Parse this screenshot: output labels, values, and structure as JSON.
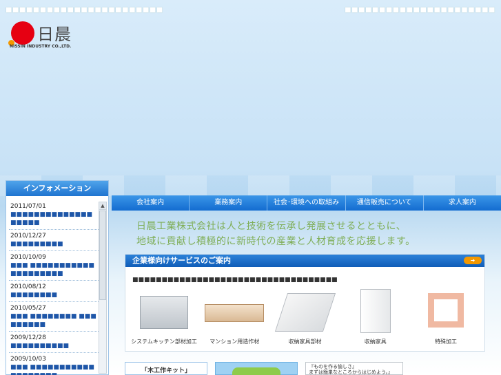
{
  "top": {
    "left_text": "■■■■■■■■■■■■■■■■■■■■■■■",
    "right_text": "■■■■■■■■■■■■■■■■■■■■■■"
  },
  "logo": {
    "mark": "日晨",
    "sub": "NISSIN INDUSTRY CO.,LTD."
  },
  "info": {
    "header": "インフォメーション",
    "items": [
      {
        "date": "2011/07/01",
        "title": "■■■■■■■■■■■■■■■■■■■"
      },
      {
        "date": "2010/12/27",
        "title": "■■■■■■■■■"
      },
      {
        "date": "2010/10/09",
        "title": "■■■ ■■■■■■■■■■■■■■■■■■■■"
      },
      {
        "date": "2010/08/12",
        "title": "■■■■■■■■"
      },
      {
        "date": "2010/05/27",
        "title": "■■■ ■■■■■■■■ ■■■■■■■■■"
      },
      {
        "date": "2009/12/28",
        "title": "■■■■■■■■■■"
      },
      {
        "date": "2009/10/03",
        "title": "■■■ ■■■■■■■■■■■■■■■■■■■"
      }
    ]
  },
  "nav": {
    "items": [
      "会社案内",
      "業務案内",
      "社会･環境への取組み",
      "通信販売について",
      "求人案内"
    ]
  },
  "catch": {
    "line1": "日晨工業株式会社は人と技術を伝承し発展させるとともに、",
    "line2": "地域に貢献し積極的に新時代の産業と人材育成を応援します。"
  },
  "service": {
    "title": "企業様向けサービスのご案内",
    "arrow": "➜",
    "desc": "■■■■■■■■■■■■■■■■■■■■■■■■■■■■■■■■■■■",
    "products": [
      {
        "label": "システムキッチン部材加工"
      },
      {
        "label": "マンション用造作材"
      },
      {
        "label": "収納家具部材"
      },
      {
        "label": "収納家具"
      },
      {
        "label": "特殊加工"
      }
    ]
  },
  "bottom": {
    "box1": "「木工作キット」",
    "box3_line1": "『ものを作る愉しさ』",
    "box3_line2": "まずは簡単なところからはじめよう。』"
  }
}
